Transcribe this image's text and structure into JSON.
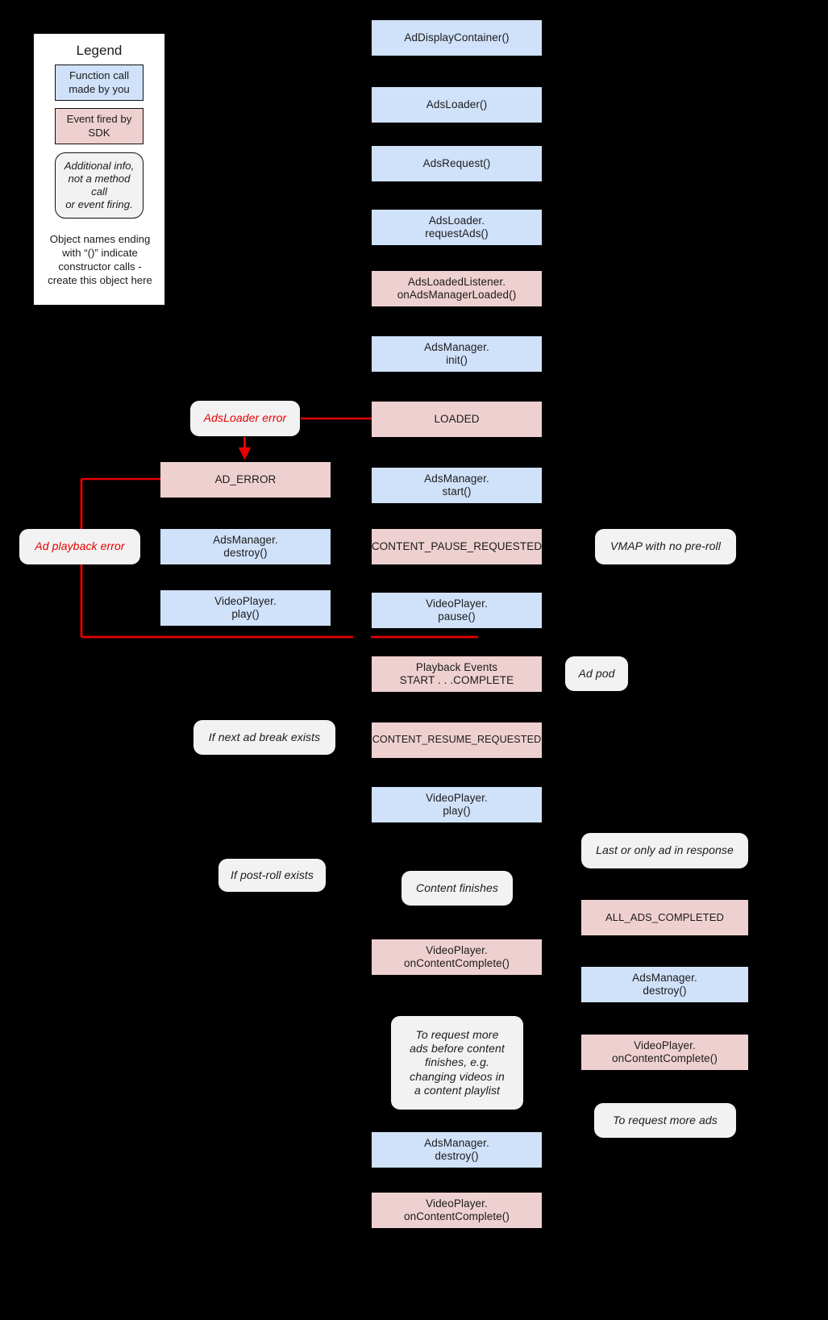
{
  "legend": {
    "title": "Legend",
    "call_label": "Function call\nmade by you",
    "event_label": "Event fired by\nSDK",
    "info_label": "Additional info,\nnot a method\ncall\nor event firing.",
    "note": "Object names ending\nwith “()” indicate\nconstructor calls -\ncreate this object here"
  },
  "colors": {
    "background": "#000000",
    "function_call": "#d0e1fa",
    "sdk_event": "#efd0d0",
    "info": "#f2f2f2",
    "error_red": "#e60000",
    "text": "#1b1b1b"
  },
  "nodes": {
    "ad_display_container": "AdDisplayContainer()",
    "ads_loader": "AdsLoader()",
    "ads_request": "AdsRequest()",
    "ads_loader_request_ads": "AdsLoader.\nrequestAds()",
    "ads_loaded_listener": "AdsLoadedListener.\nonAdsManagerLoaded()",
    "ads_manager_init": "AdsManager.\ninit()",
    "loaded": "LOADED",
    "ads_manager_start": "AdsManager.\nstart()",
    "content_pause_requested": "CONTENT_PAUSE_REQUESTED",
    "video_player_pause": "VideoPlayer.\npause()",
    "playback_events": "Playback Events\nSTART . . .COMPLETE",
    "content_resume_requested": "CONTENT_RESUME_REQUESTED",
    "video_player_play_mid": "VideoPlayer.\nplay()",
    "content_finishes": "Content finishes",
    "video_player_on_content_complete_mid": "VideoPlayer.\nonContentComplete()",
    "request_more_ads_note": "To request more\nads before content\nfinishes, e.g.\nchanging videos in\na content playlist",
    "ads_manager_destroy_mid": "AdsManager.\ndestroy()",
    "video_player_on_content_complete_bottom": "VideoPlayer.\nonContentComplete()",
    "ads_loader_error": "AdsLoader error",
    "ad_error": "AD_ERROR",
    "ad_playback_error": "Ad playback error",
    "ads_manager_destroy_left": "AdsManager.\ndestroy()",
    "video_player_play_left": "VideoPlayer.\nplay()",
    "if_next_ad_break_exists": "If next ad break exists",
    "if_post_roll_exists": "If post-roll exists",
    "vmap_no_preroll": "VMAP with no pre-roll",
    "ad_pod": "Ad pod",
    "last_or_only_ad": "Last or only ad in response",
    "all_ads_completed": "ALL_ADS_COMPLETED",
    "ads_manager_destroy_right": "AdsManager.\ndestroy()",
    "video_player_on_content_complete_right": "VideoPlayer.\nonContentComplete()",
    "to_request_more_ads": "To request more ads"
  }
}
